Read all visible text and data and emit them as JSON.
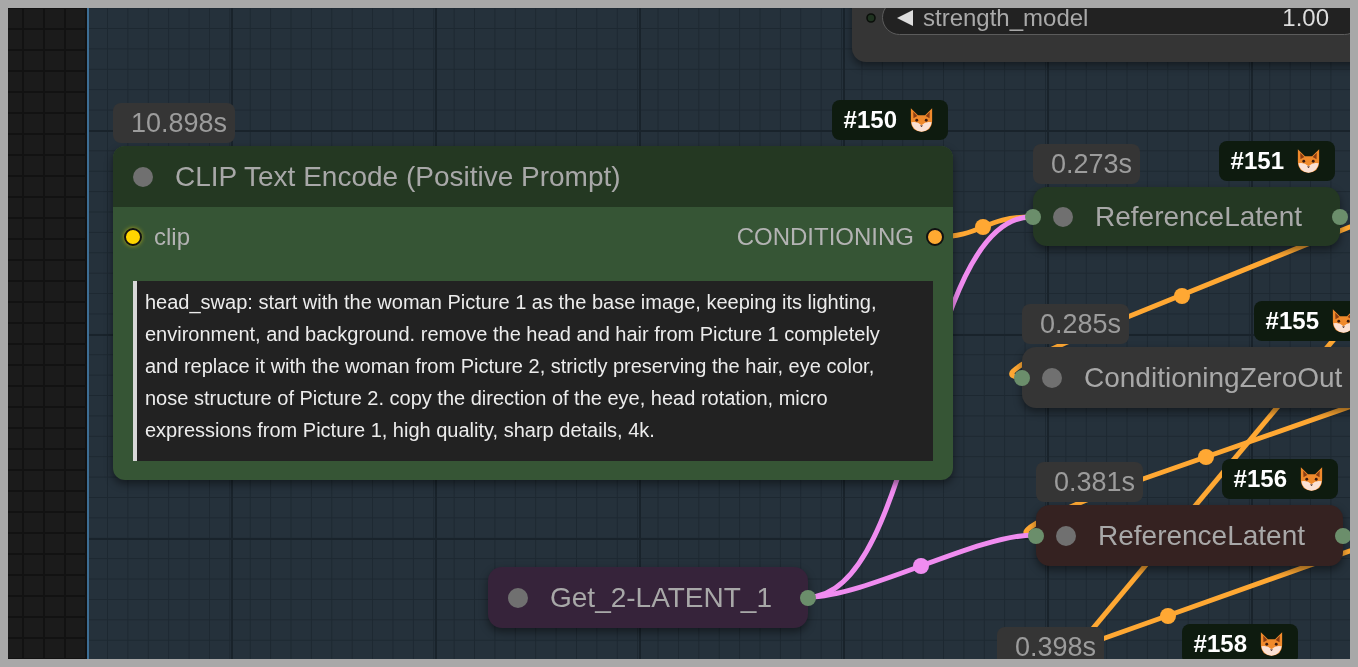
{
  "canvas": {
    "nodes": [
      {
        "color": "#353535",
        "collapsed": false,
        "widgets": [
          {
            "kind": "number",
            "label": "strength_model",
            "value": "1.00"
          }
        ]
      },
      {
        "time": "10.898s",
        "id": "#150",
        "title_bar": {
          "title": "CLIP Text Encode (Positive Prompt)",
          "color": "#243822"
        },
        "color": "#365535",
        "collapsed": false,
        "inputs": [
          {
            "label": "clip",
            "color": "#ffd500"
          }
        ],
        "outputs": [
          {
            "label": "CONDITIONING",
            "color": "#ffa931"
          }
        ],
        "widgets": [
          {
            "kind": "text",
            "value": "head_swap: start with the woman Picture 1 as the base image, keeping its lighting, environment, and background. remove the head and hair from Picture 1 completely and replace it with the woman from Picture 2, strictly preserving the hair, eye color, nose structure of Picture 2. copy the direction of the eye, head rotation, micro expressions from Picture 1, high quality, sharp details, 4k."
          }
        ]
      },
      {
        "time": "0.273s",
        "id": "#151",
        "title": "ReferenceLatent",
        "color": "#243823",
        "collapsed": true,
        "inputs": [
          {
            "color": "#6b8e6b"
          }
        ],
        "outputs": [
          {
            "color": "#6b8e6b"
          }
        ]
      },
      {
        "time": "0.285s",
        "id": "#155",
        "title": "ConditioningZeroOut",
        "color": "#353535",
        "collapsed": true,
        "inputs": [
          {
            "color": "#6b8e6b"
          }
        ]
      },
      {
        "time": "0.381s",
        "id": "#156",
        "title": "ReferenceLatent",
        "color": "#352221",
        "collapsed": true,
        "inputs": [
          {
            "color": "#6b8e6b"
          }
        ],
        "outputs": [
          {
            "color": "#6b8e6b"
          }
        ]
      },
      {
        "title": "Get_2-LATENT_1",
        "color": "#36233a",
        "collapsed": true,
        "outputs": [
          {
            "color": "#6b8e6b"
          }
        ]
      },
      {
        "time": "0.398s",
        "id": "#158"
      }
    ]
  }
}
